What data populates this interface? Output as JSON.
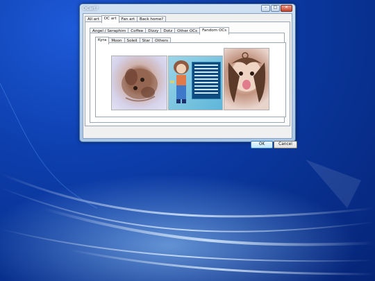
{
  "window": {
    "title": "OCart?",
    "controls": {
      "minimize": "–",
      "maximize": "□",
      "close": "✕"
    }
  },
  "top_tabs": [
    "All art",
    "OC art",
    "Fan art",
    "Back home?"
  ],
  "top_tabs_active": "OC art",
  "oc_tabs": [
    "Angel / Seraphim",
    "Coffee",
    "Dizzy",
    "Dotz",
    "Other OCs",
    "Fandom OCs"
  ],
  "oc_tabs_active": "Fandom OCs",
  "fandom_tabs": [
    "Kyra",
    "Moon",
    "Soleil",
    "Star",
    "Others"
  ],
  "fandom_tabs_active": "Kyra",
  "images": [
    {
      "name": "kyra-sketch-image"
    },
    {
      "name": "kyra-reference-sheet-image"
    },
    {
      "name": "kyra-tongue-out-image"
    }
  ],
  "buttons": {
    "ok": "OK",
    "cancel": "Cancel"
  },
  "colors": {
    "desktop_dark": "#062476",
    "desktop_light": "#1e5ad8",
    "window_frame": "#b8d0ea",
    "ok_accent": "#3c7fb1"
  }
}
